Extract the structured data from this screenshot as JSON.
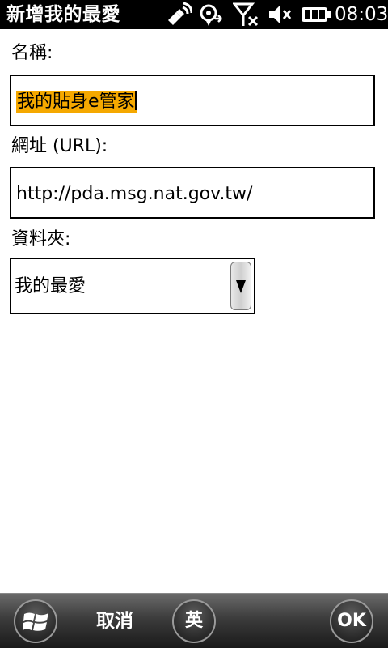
{
  "statusbar": {
    "title": "新增我的最愛",
    "clock": "08:03",
    "icons": [
      "signal-antenna-icon",
      "gps-sync-icon",
      "no-signal-icon",
      "volume-muted-icon",
      "battery-icon"
    ]
  },
  "form": {
    "name_label": "名稱:",
    "name_value": "我的貼身e管家",
    "url_label": "網址 (URL):",
    "url_value": "http://pda.msg.nat.gov.tw/",
    "folder_label": "資料夾:",
    "folder_value": "我的最愛"
  },
  "softbar": {
    "cancel_label": "取消",
    "ime_label": "英",
    "ok_label": "OK"
  },
  "colors": {
    "selection": "#f5a800",
    "statusbar_bg": "#000000"
  }
}
